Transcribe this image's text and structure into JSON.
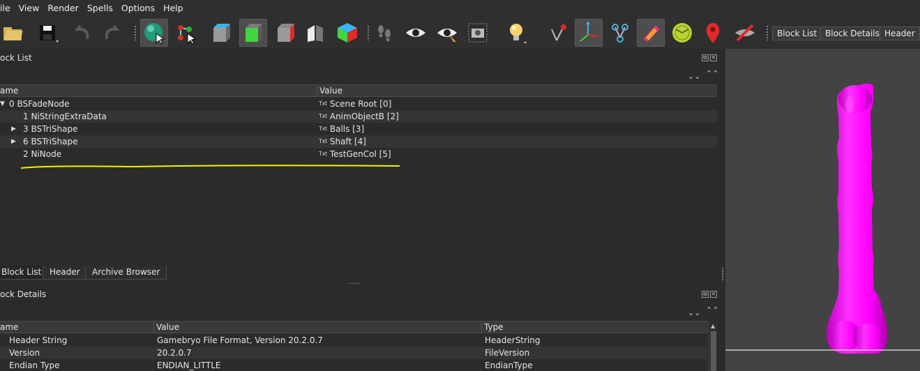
{
  "menu": [
    "ile",
    "View",
    "Render",
    "Spells",
    "Options",
    "Help"
  ],
  "toolbar": {
    "icons": [
      "load-icon",
      "save-icon",
      "undo-icon",
      "redo-icon",
      "select-object-icon",
      "select-vertex-icon",
      "view-top-icon",
      "view-front-icon",
      "view-side-icon",
      "view-user-icon",
      "view-perspective-icon",
      "walk-icon",
      "show-hidden-icon",
      "show-selected-icon",
      "screenshot-icon",
      "lighting-icon",
      "show-axes-icon",
      "show-nodes-icon",
      "show-collision-icon",
      "show-constraints-icon",
      "show-markers-icon",
      "show-furniture-icon",
      "hide-icon"
    ],
    "text_buttons": [
      "Block List",
      "Block Details",
      "Header"
    ]
  },
  "block_list": {
    "title": "ock List",
    "columns": [
      "ame",
      "Value"
    ],
    "rows": [
      {
        "name": "0 BSFadeNode",
        "value": "Scene Root [0]"
      },
      {
        "name": "1 NiStringExtraData",
        "value": "AnimObjectB [2]"
      },
      {
        "name": "3 BSTriShape",
        "value": "Balls [3]"
      },
      {
        "name": "6 BSTriShape",
        "value": "Shaft [4]"
      },
      {
        "name": "2 NiNode",
        "value": "TestGenCol [5]"
      }
    ]
  },
  "tabs": [
    "Block List",
    "Header",
    "Archive Browser"
  ],
  "splitter_dots": "......",
  "block_details": {
    "title": "ock Details",
    "columns": [
      "ame",
      "Value",
      "Type"
    ],
    "rows": [
      {
        "name": "Header String",
        "value": "Gamebryo File Format, Version 20.2.0.7",
        "type": "HeaderString"
      },
      {
        "name": "Version",
        "value": "20.2.0.7",
        "type": "FileVersion"
      },
      {
        "name": "Endian Type",
        "value": "ENDIAN_LITTLE",
        "type": "EndianType"
      }
    ]
  },
  "glyphs": {
    "txt": "Txt",
    "expand": "▶",
    "collapse": "▼",
    "chev_down": "⌄⌄",
    "chev_up": "⌃⌃"
  },
  "colors": {
    "highlight_underline": "#f2f200",
    "model": "#ff00ff",
    "viewport_bg": "#434343"
  }
}
